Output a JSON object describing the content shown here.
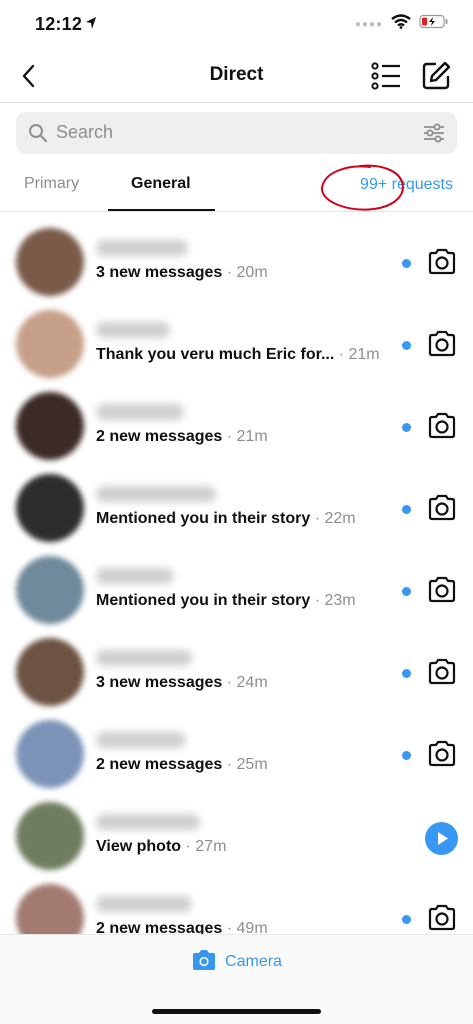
{
  "status": {
    "time": "12:12"
  },
  "nav": {
    "title": "Direct"
  },
  "search": {
    "placeholder": "Search"
  },
  "tabs": {
    "primary": "Primary",
    "general": "General",
    "requests": "99+ requests"
  },
  "conversations": [
    {
      "message": "3 new messages",
      "time": "· 20m",
      "avatar_color": "#7a5a48",
      "unread": true,
      "action": "camera-icon"
    },
    {
      "message": "Thank you veru much Eric for...",
      "time": "· 21m",
      "avatar_color": "#c7a08a",
      "unread": true,
      "action": "camera-icon"
    },
    {
      "message": "2 new messages",
      "time": "· 21m",
      "avatar_color": "#3b2a26",
      "unread": true,
      "action": "camera-icon"
    },
    {
      "message": "Mentioned you in their story",
      "time": "· 22m",
      "avatar_color": "#2c2c2c",
      "unread": true,
      "action": "camera-icon"
    },
    {
      "message": "Mentioned you in their story",
      "time": "· 23m",
      "avatar_color": "#6f8a9a",
      "unread": true,
      "action": "camera-icon"
    },
    {
      "message": "3 new messages",
      "time": "· 24m",
      "avatar_color": "#6d5343",
      "unread": true,
      "action": "camera-icon"
    },
    {
      "message": "2 new messages",
      "time": "· 25m",
      "avatar_color": "#7c93b8",
      "unread": true,
      "action": "camera-icon"
    },
    {
      "message": "View photo",
      "time": "· 27m",
      "avatar_color": "#6e7d5e",
      "unread": false,
      "action": "play-icon"
    },
    {
      "message": "2 new messages",
      "time": "· 49m",
      "avatar_color": "#a37a70",
      "unread": true,
      "action": "camera-icon"
    }
  ],
  "bottom": {
    "camera_label": "Camera"
  },
  "colors": {
    "accent": "#3897f0",
    "annotation": "#d0021b"
  }
}
